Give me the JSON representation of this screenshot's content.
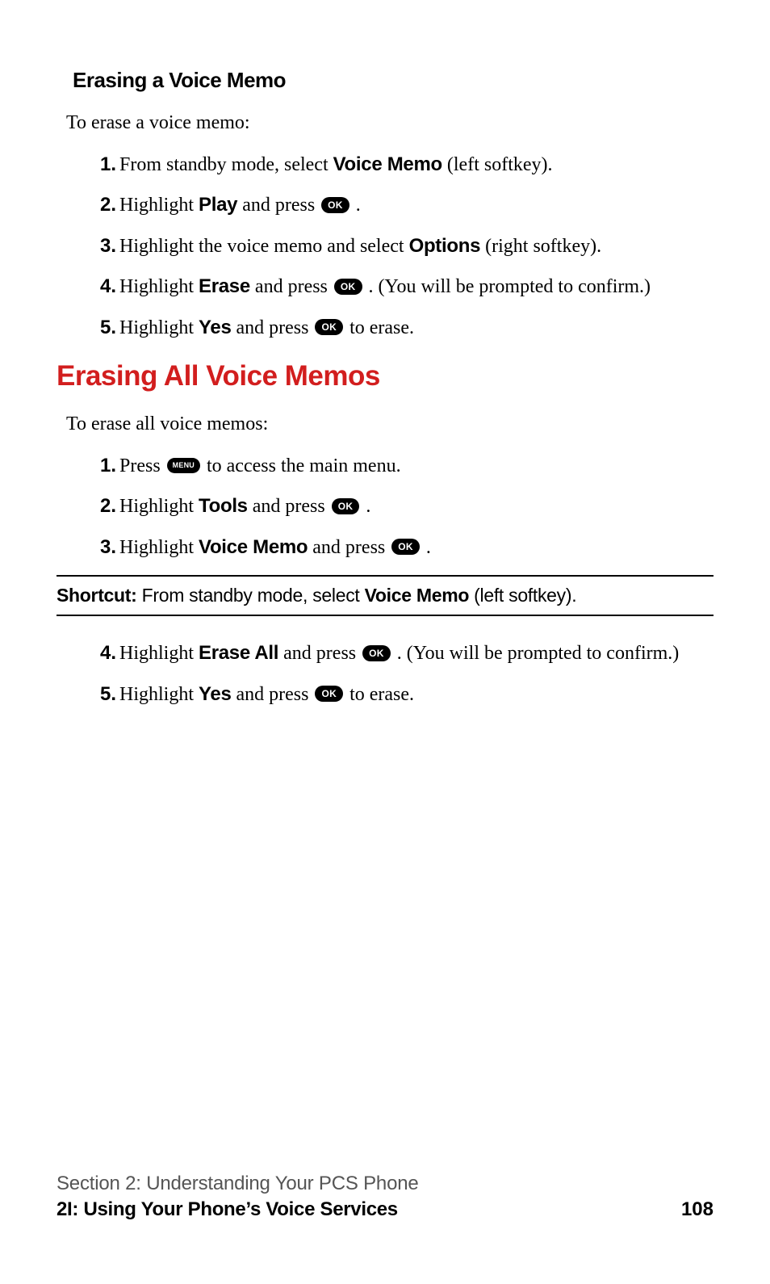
{
  "section1": {
    "heading": "Erasing a Voice Memo",
    "intro": "To erase a voice memo:",
    "steps": {
      "s1": {
        "num": "1.",
        "a": "From standby mode, select ",
        "b": "Voice Memo",
        "c": " (left softkey)."
      },
      "s2": {
        "num": "2.",
        "a": "Highlight ",
        "b": "Play",
        "c": " and press ",
        "btn": "OK",
        "d": " ."
      },
      "s3": {
        "num": "3.",
        "a": "Highlight the voice memo and select ",
        "b": "Options",
        "c": " (right softkey)."
      },
      "s4": {
        "num": "4.",
        "a": "Highlight ",
        "b": "Erase",
        "c": " and press ",
        "btn": "OK",
        "d": " . (You will be prompted to confirm.)"
      },
      "s5": {
        "num": "5.",
        "a": "Highlight ",
        "b": "Yes",
        "c": " and press ",
        "btn": "OK",
        "d": " to erase."
      }
    }
  },
  "section2": {
    "heading": "Erasing All Voice Memos",
    "intro": "To erase all voice memos:",
    "stepsA": {
      "s1": {
        "num": "1.",
        "a": "Press ",
        "btn": "MENU",
        "c": " to access the main menu."
      },
      "s2": {
        "num": "2.",
        "a": "Highlight ",
        "b": "Tools",
        "c": " and press ",
        "btn": "OK",
        "d": " ."
      },
      "s3": {
        "num": "3.",
        "a": "Highlight ",
        "b": "Voice Memo",
        "c": " and press ",
        "btn": "OK",
        "d": " ."
      }
    },
    "shortcut": {
      "label": "Shortcut:",
      "a": " From standby mode, select ",
      "b": "Voice Memo",
      "c": " (left softkey)."
    },
    "stepsB": {
      "s4": {
        "num": "4.",
        "a": "Highlight ",
        "b": "Erase All",
        "c": " and press ",
        "btn": "OK",
        "d": " . (You will be prompted to confirm.)"
      },
      "s5": {
        "num": "5.",
        "a": "Highlight ",
        "b": "Yes",
        "c": " and press ",
        "btn": "OK",
        "d": " to erase."
      }
    }
  },
  "footer": {
    "section": "Section 2: Understanding Your PCS Phone",
    "subsection": "2I: Using Your Phone’s Voice Services",
    "page": "108"
  }
}
